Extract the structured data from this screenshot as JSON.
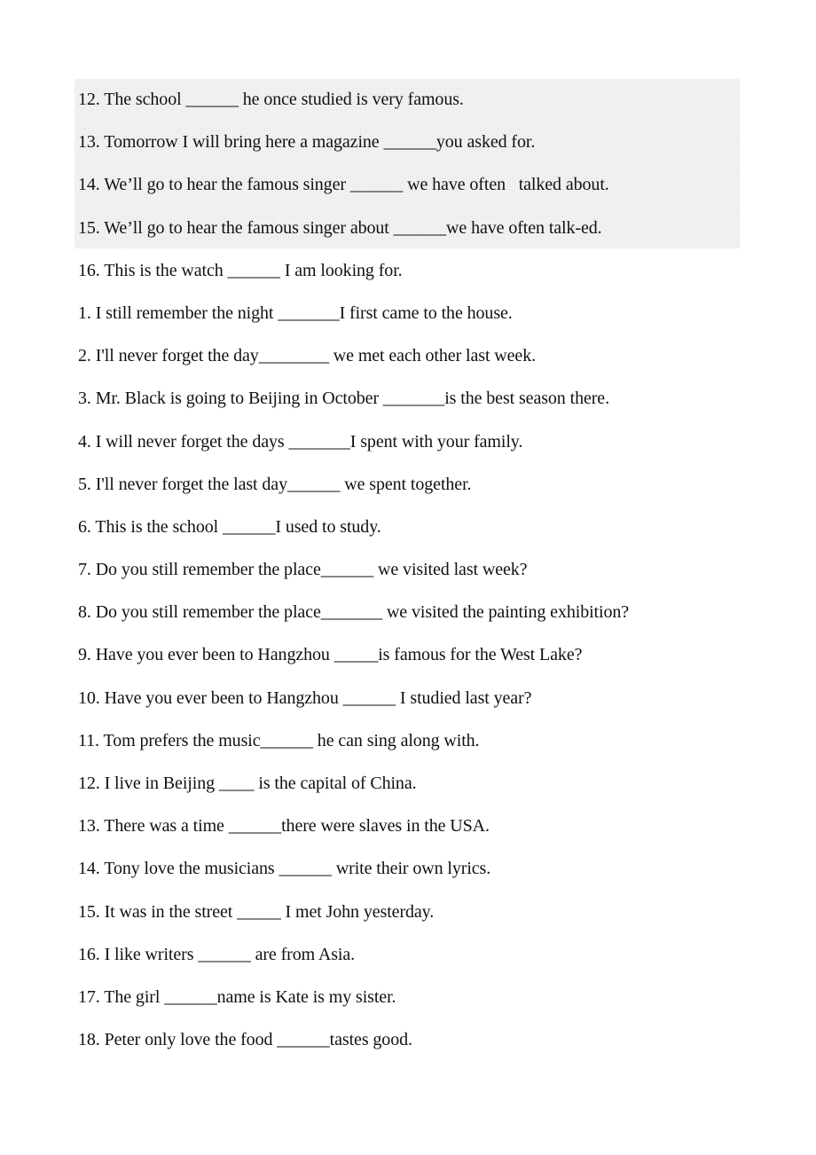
{
  "highlight_color": "#f1f1f1",
  "exercise": {
    "shaded_items": [
      "12. The school ______ he once studied is very famous.",
      "13. Tomorrow I will bring here a magazine ______you asked for.",
      "14. We’ll go to hear the famous singer ______ we have often   talked about.",
      "15. We’ll go to hear the famous singer about ______we have often talk-ed."
    ],
    "items": [
      "16. This is the watch ______ I am looking for.",
      "1. I still remember the night _______I first came to the house.",
      "2. I'll never forget the day________ we met each other last week.",
      "3. Mr. Black is going to Beijing in October _______is the best season there.",
      "4. I will never forget the days _______I spent with your family.",
      "5. I'll never forget the last day______ we spent together.",
      "6. This is the school ______I used to study.",
      "7. Do you still remember the place______ we visited last week?",
      "8. Do you still remember the place_______ we visited the painting exhibition?",
      "9. Have you ever been to Hangzhou _____is famous for the West Lake?",
      "10. Have you ever been to Hangzhou ______ I studied last year?",
      "11. Tom prefers the music______ he can sing along with.",
      "12. I live in Beijing ____ is the capital of China.",
      "13. There was a time ______there were slaves in the USA.",
      "14. Tony love the musicians ______ write their own lyrics.",
      "15. It was in the street _____ I met John yesterday.",
      "16. I like writers ______ are from Asia.",
      "17. The girl ______name is Kate is my sister.",
      "18. Peter only love the food ______tastes good."
    ]
  }
}
